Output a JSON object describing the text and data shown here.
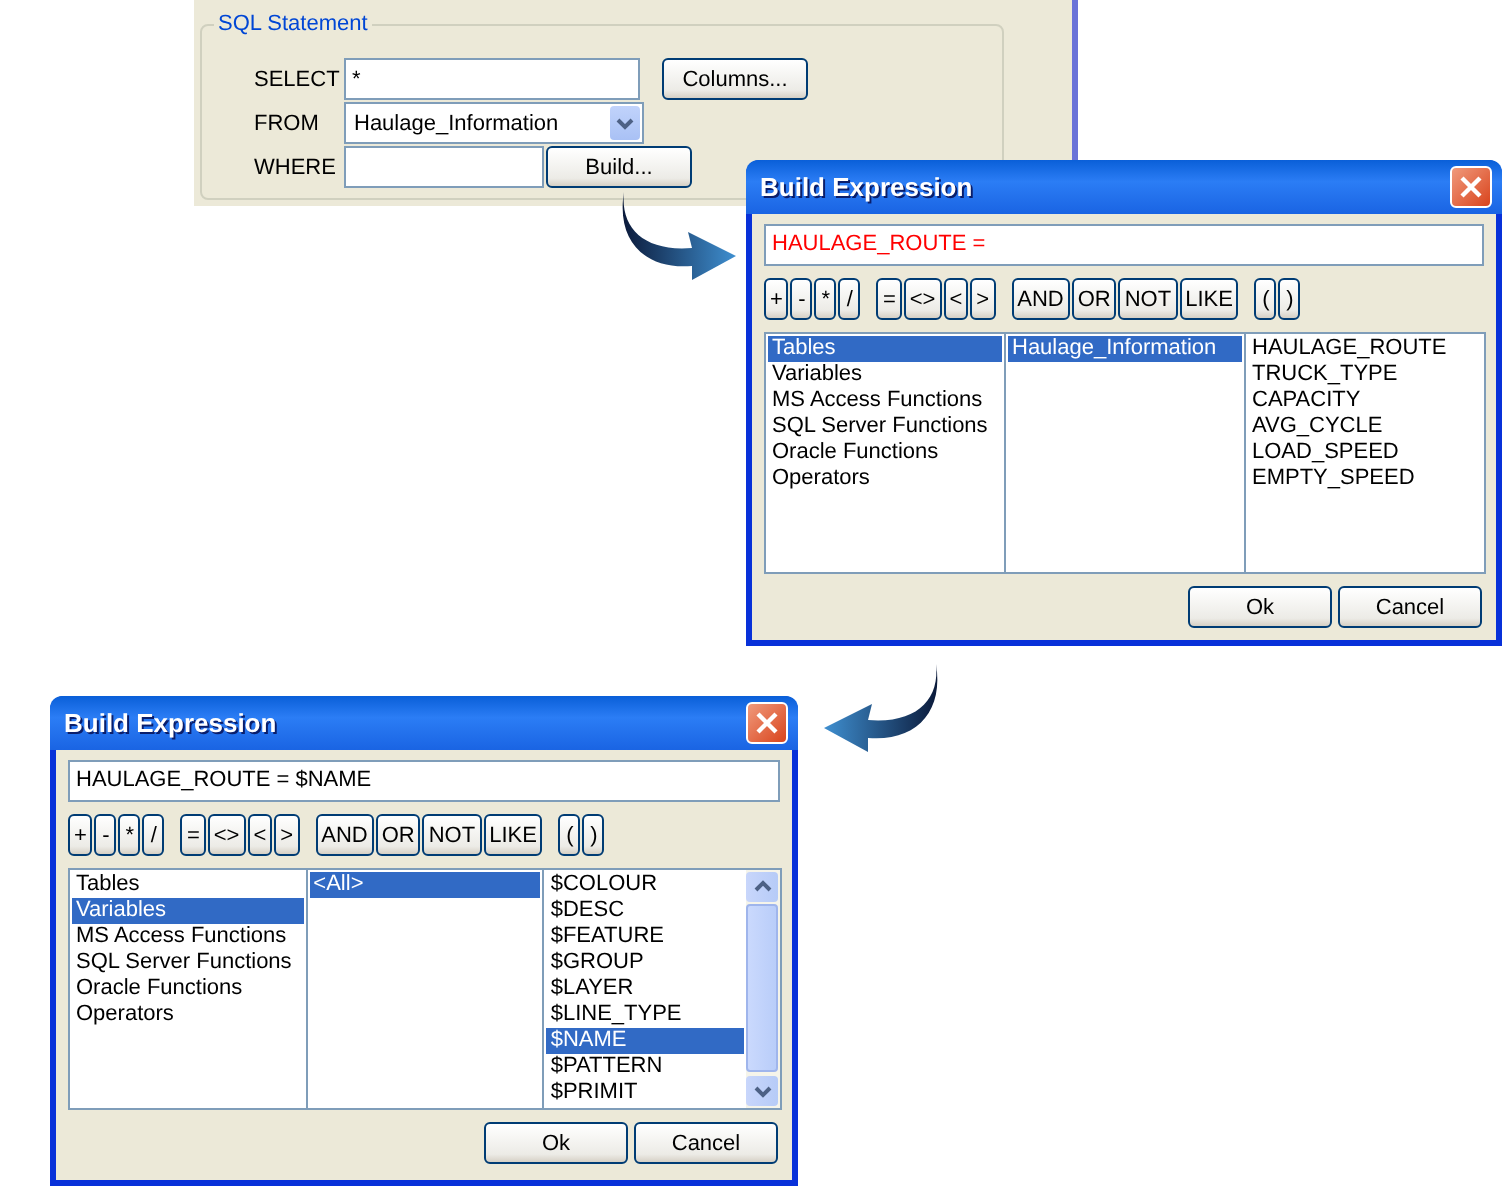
{
  "sql_panel": {
    "title": "SQL Statement",
    "rows": [
      {
        "kind": "input",
        "label": "SELECT",
        "value": "*",
        "button": "Columns..."
      },
      {
        "kind": "combo",
        "label": "FROM",
        "value": "Haulage_Information"
      },
      {
        "kind": "input",
        "label": "WHERE",
        "value": "",
        "button": "Build..."
      }
    ]
  },
  "dialogs": [
    {
      "title": "Build Expression",
      "expression": {
        "text": "HAULAGE_ROUTE =",
        "color": "#ff0000"
      },
      "operators": [
        [
          "+",
          "-",
          "*",
          "/"
        ],
        [
          "=",
          "<>",
          "<",
          ">"
        ],
        [
          "AND",
          "OR",
          "NOT",
          "LIKE"
        ],
        [
          "(",
          ")"
        ]
      ],
      "lists": [
        {
          "scrollbar": false,
          "items": [
            {
              "text": "Tables",
              "selected": true
            },
            {
              "text": "Variables",
              "selected": false
            },
            {
              "text": "MS Access Functions",
              "selected": false
            },
            {
              "text": "SQL Server Functions",
              "selected": false
            },
            {
              "text": "Oracle Functions",
              "selected": false
            },
            {
              "text": "Operators",
              "selected": false
            }
          ]
        },
        {
          "scrollbar": false,
          "items": [
            {
              "text": "Haulage_Information",
              "selected": true
            }
          ]
        },
        {
          "scrollbar": false,
          "items": [
            {
              "text": "HAULAGE_ROUTE",
              "selected": false
            },
            {
              "text": "TRUCK_TYPE",
              "selected": false
            },
            {
              "text": "CAPACITY",
              "selected": false
            },
            {
              "text": "AVG_CYCLE",
              "selected": false
            },
            {
              "text": "LOAD_SPEED",
              "selected": false
            },
            {
              "text": "EMPTY_SPEED",
              "selected": false
            }
          ]
        }
      ],
      "buttons": [
        "Ok",
        "Cancel"
      ]
    },
    {
      "title": "Build Expression",
      "expression": {
        "text": "HAULAGE_ROUTE = $NAME",
        "color": "#000000"
      },
      "operators": [
        [
          "+",
          "-",
          "*",
          "/"
        ],
        [
          "=",
          "<>",
          "<",
          ">"
        ],
        [
          "AND",
          "OR",
          "NOT",
          "LIKE"
        ],
        [
          "(",
          ")"
        ]
      ],
      "lists": [
        {
          "scrollbar": false,
          "items": [
            {
              "text": "Tables",
              "selected": false
            },
            {
              "text": "Variables",
              "selected": true
            },
            {
              "text": "MS Access Functions",
              "selected": false
            },
            {
              "text": "SQL Server Functions",
              "selected": false
            },
            {
              "text": "Oracle Functions",
              "selected": false
            },
            {
              "text": "Operators",
              "selected": false
            }
          ]
        },
        {
          "scrollbar": false,
          "items": [
            {
              "text": "<All>",
              "selected": true
            }
          ]
        },
        {
          "scrollbar": true,
          "items": [
            {
              "text": "$COLOUR",
              "selected": false
            },
            {
              "text": "$DESC",
              "selected": false
            },
            {
              "text": "$FEATURE",
              "selected": false
            },
            {
              "text": "$GROUP",
              "selected": false
            },
            {
              "text": "$LAYER",
              "selected": false
            },
            {
              "text": "$LINE_TYPE",
              "selected": false
            },
            {
              "text": "$NAME",
              "selected": true
            },
            {
              "text": "$PATTERN",
              "selected": false
            },
            {
              "text": "$PRIMIT",
              "selected": false
            }
          ]
        }
      ],
      "buttons": [
        "Ok",
        "Cancel"
      ]
    }
  ]
}
